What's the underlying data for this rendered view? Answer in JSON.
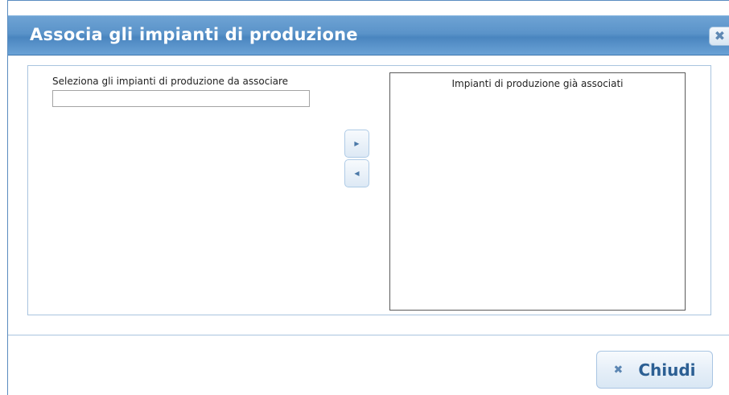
{
  "dialog": {
    "title": "Associa gli impianti di produzione",
    "close_icon": "close-icon",
    "close_glyph": "✖"
  },
  "left": {
    "label": "Seleziona gli impianti di produzione da associare",
    "input_value": "",
    "input_placeholder": ""
  },
  "transfer": {
    "add_icon": "triangle-right-icon",
    "add_glyph": "▶",
    "remove_icon": "triangle-left-icon",
    "remove_glyph": "◀"
  },
  "right": {
    "label": "Impianti di produzione già associati"
  },
  "footer": {
    "close_label": "Chiudi",
    "close_icon": "close-icon",
    "close_glyph": "✖"
  },
  "colors": {
    "title_bar": "#5a93c9",
    "title_text": "#ffffff",
    "border": "#a9c4df",
    "button_text": "#2c5f93"
  }
}
